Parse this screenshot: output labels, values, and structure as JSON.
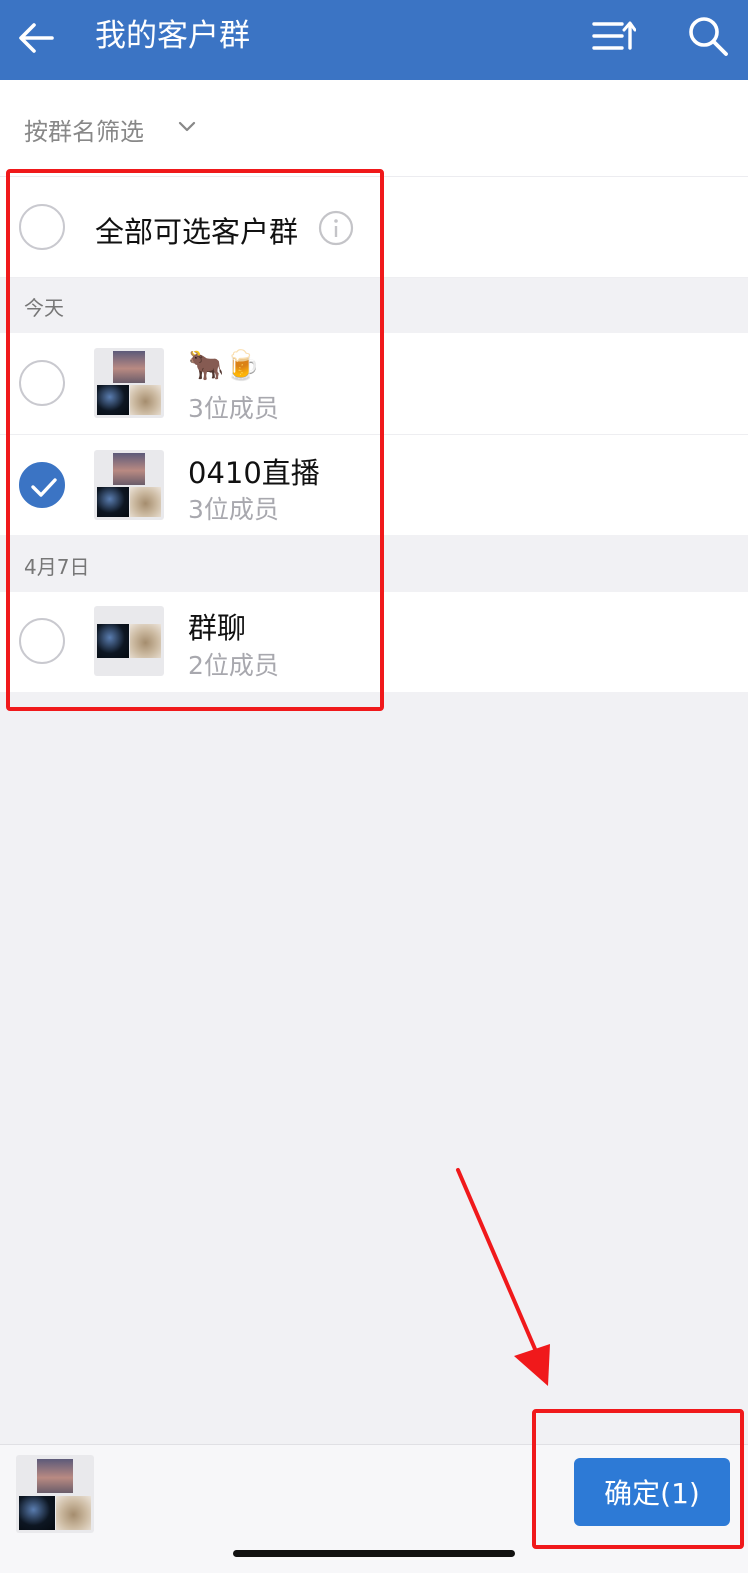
{
  "header": {
    "title": "我的客户群",
    "back_icon": "arrow-left-icon",
    "sort_icon": "sort-icon",
    "search_icon": "search-icon",
    "bg_color": "#3b74c4"
  },
  "filter": {
    "label": "按群名筛选",
    "icon": "chevron-down-icon"
  },
  "select_all": {
    "label": "全部可选客户群",
    "checked": false,
    "info_icon": "info-icon"
  },
  "sections": [
    {
      "label": "今天",
      "groups": [
        {
          "name": "🐂🍺",
          "members": "3位成员",
          "checked": false
        },
        {
          "name": "0410直播",
          "members": "3位成员",
          "checked": true
        }
      ]
    },
    {
      "label": "4月7日",
      "groups": [
        {
          "name": "群聊",
          "members": "2位成员",
          "checked": false
        }
      ]
    }
  ],
  "footer": {
    "confirm_label": "确定(1)",
    "accent": "#2d7ad6"
  },
  "annotation_color": "#f0191b"
}
